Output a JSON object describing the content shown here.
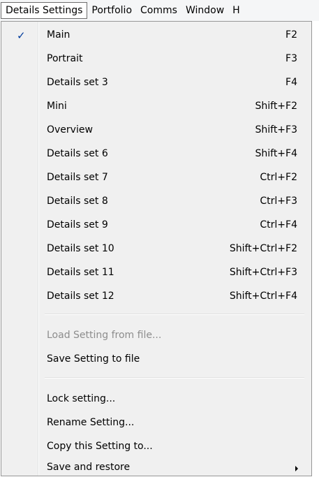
{
  "menubar": {
    "items": [
      {
        "label": "Details Settings"
      },
      {
        "label": "Portfolio"
      },
      {
        "label": "Comms"
      },
      {
        "label": "Window"
      },
      {
        "label": "H"
      }
    ]
  },
  "menu": {
    "items": [
      {
        "label": "Main",
        "shortcut": "F2",
        "checked": true
      },
      {
        "label": "Portrait",
        "shortcut": "F3"
      },
      {
        "label": "Details set 3",
        "shortcut": "F4"
      },
      {
        "label": "Mini",
        "shortcut": "Shift+F2"
      },
      {
        "label": "Overview",
        "shortcut": "Shift+F3"
      },
      {
        "label": "Details set 6",
        "shortcut": "Shift+F4"
      },
      {
        "label": "Details set 7",
        "shortcut": "Ctrl+F2"
      },
      {
        "label": "Details set 8",
        "shortcut": "Ctrl+F3"
      },
      {
        "label": "Details set 9",
        "shortcut": "Ctrl+F4"
      },
      {
        "label": "Details set 10",
        "shortcut": "Shift+Ctrl+F2"
      },
      {
        "label": "Details set 11",
        "shortcut": "Shift+Ctrl+F3"
      },
      {
        "label": "Details set 12",
        "shortcut": "Shift+Ctrl+F4"
      }
    ],
    "file_items": [
      {
        "label": "Load Setting from file...",
        "disabled": true
      },
      {
        "label": "Save Setting to file"
      }
    ],
    "setting_items": [
      {
        "label": "Lock setting..."
      },
      {
        "label": "Rename Setting..."
      },
      {
        "label": "Copy this Setting to..."
      },
      {
        "label": "Save and restore",
        "submenu": true
      }
    ],
    "check_glyph": "✓"
  }
}
